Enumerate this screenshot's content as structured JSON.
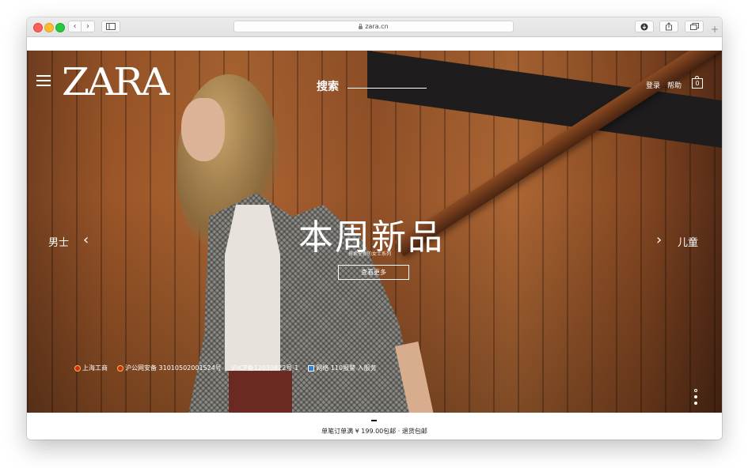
{
  "browser": {
    "url": "zara.cn",
    "back_icon": "‹",
    "forward_icon": "›",
    "new_tab_icon": "+"
  },
  "header": {
    "logo": "ZARA",
    "search_label": "搜索",
    "login": "登录",
    "help": "帮助",
    "cart_count": "0"
  },
  "hero": {
    "headline": "本周新品",
    "subline": "探索全新的女士系列",
    "cta": "查看更多",
    "nav_left": "男士",
    "nav_right": "儿童",
    "arrow_left": "‹",
    "arrow_right": "›"
  },
  "footer_links": [
    {
      "label": "上海工商"
    },
    {
      "label": "沪公网安备 31010502001524号"
    },
    {
      "label": "沪ICP备12030822号-1"
    },
    {
      "label": "网络 110报警 入服务"
    }
  ],
  "promo": "单笔订单满 ¥ 199.00包邮 · 退货包邮",
  "colors": {
    "accent": "#ffffff",
    "wood": "#a35a2a"
  }
}
